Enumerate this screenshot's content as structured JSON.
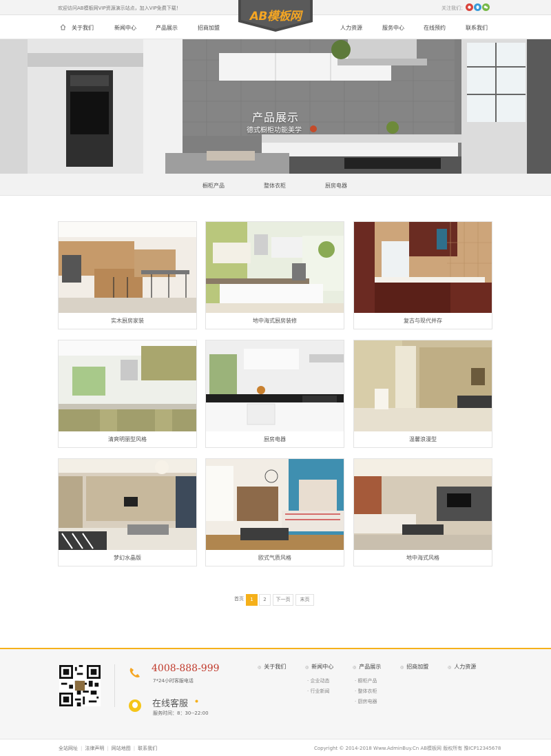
{
  "topbar": {
    "welcome": "欢迎访问AB模板网VIP资源演示站点，加入VIP免费下载！",
    "follow": "关注我们："
  },
  "logo": {
    "text": "AB模板网"
  },
  "nav": {
    "left": [
      "关于我们",
      "新闻中心",
      "产品展示",
      "招商加盟"
    ],
    "right": [
      "人力资源",
      "服务中心",
      "在线预约",
      "联系我们"
    ]
  },
  "banner": {
    "title": "产品展示",
    "subtitle": "德式橱柜功能美学"
  },
  "subnav": [
    "橱柜产品",
    "整体衣柜",
    "厨房电器"
  ],
  "products": [
    {
      "caption": "实木厨房家装"
    },
    {
      "caption": "地中海式厨房装修"
    },
    {
      "caption": "复古与现代并存"
    },
    {
      "caption": "清爽明丽型风格"
    },
    {
      "caption": "厨房电器"
    },
    {
      "caption": "温馨浪漫型"
    },
    {
      "caption": "梦幻水晶版"
    },
    {
      "caption": "欧式气质风格"
    },
    {
      "caption": "地中海式风格"
    }
  ],
  "pagination": {
    "first": "首页",
    "pages": [
      "1",
      "2"
    ],
    "next": "下一页",
    "last": "末页",
    "current": "1"
  },
  "footer": {
    "phone": "4008-888-999",
    "phone_note": "7*24小时客服电话",
    "service_title": "在线客服",
    "service_time": "服务时间：8：30--22:00",
    "columns": [
      {
        "title": "关于我们",
        "items": []
      },
      {
        "title": "新闻中心",
        "items": [
          "企业动态",
          "行业新闻"
        ]
      },
      {
        "title": "产品展示",
        "items": [
          "橱柜产品",
          "整体衣柜",
          "厨房电器"
        ]
      },
      {
        "title": "招商加盟",
        "items": []
      },
      {
        "title": "人力资源",
        "items": []
      }
    ],
    "bottom_links": [
      "全站网址",
      "法律声明",
      "网站地图",
      "联系我们"
    ],
    "copyright": "Copyright © 2014-2018 Www.AdminBuy.Cn AB模板网 版权所有 豫ICP12345678"
  },
  "colors": {
    "accent": "#f5b01a",
    "phone": "#c0392b"
  }
}
